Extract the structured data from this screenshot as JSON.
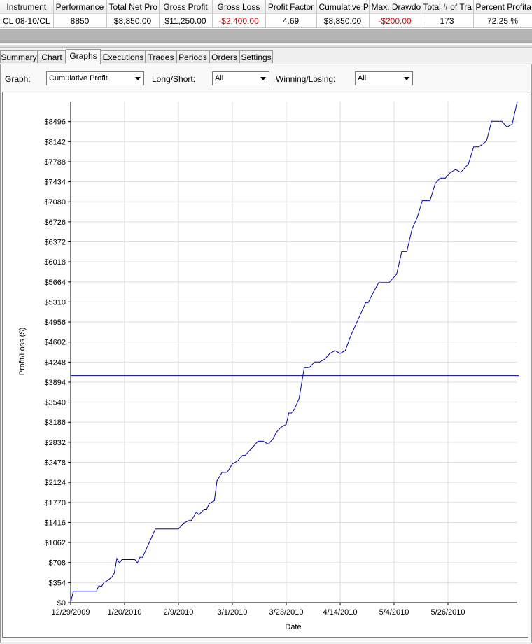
{
  "summary": {
    "columns": [
      "Instrument",
      "Performance",
      "Total Net Pro",
      "Gross Profit",
      "Gross Loss",
      "Profit Factor",
      "Cumulative P",
      "Max. Drawdo",
      "Total # of Tra",
      "Percent Profita"
    ],
    "row": [
      "CL 08-10/CL",
      "8850",
      "$8,850.00",
      "$11,250.00",
      "-$2,400.00",
      "4.69",
      "$8,850.00",
      "-$200.00",
      "173",
      "72.25 %"
    ],
    "negative_color": "#e00000"
  },
  "tabs": [
    "Summary",
    "Chart",
    "Graphs",
    "Executions",
    "Trades",
    "Periods",
    "Orders",
    "Settings"
  ],
  "active_tab": "Graphs",
  "filters": {
    "graph_label": "Graph:",
    "graph_value": "Cumulative Profit",
    "long_short_label": "Long/Short:",
    "long_short_value": "All",
    "winning_losing_label": "Winning/Losing:",
    "winning_losing_value": "All"
  },
  "chart_data": {
    "type": "line",
    "xlabel": "Date",
    "ylabel": "Profit/Loss ($)",
    "x_tick_labels": [
      "12/29/2009",
      "1/20/2010",
      "2/9/2010",
      "3/1/2010",
      "3/23/2010",
      "4/14/2010",
      "5/4/2010",
      "5/26/2010"
    ],
    "x_range": [
      "2009-12-29",
      "2010-06-21"
    ],
    "y_ticks": [
      0,
      354,
      708,
      1062,
      1416,
      1770,
      2124,
      2478,
      2832,
      3186,
      3540,
      3894,
      4248,
      4602,
      4956,
      5310,
      5664,
      6018,
      6372,
      6726,
      7080,
      7434,
      7788,
      8142,
      8496
    ],
    "y_tick_labels": [
      "$0",
      "$354",
      "$708",
      "$1062",
      "$1416",
      "$1770",
      "$2124",
      "$2478",
      "$2832",
      "$3186",
      "$3540",
      "$3894",
      "$4248",
      "$4602",
      "$4956",
      "$5310",
      "$5664",
      "$6018",
      "$6372",
      "$6726",
      "$7080",
      "$7434",
      "$7788",
      "$8142",
      "$8496"
    ],
    "ylim": [
      0,
      8850
    ],
    "grid": true,
    "line_color": "#0000b4",
    "reference_line": {
      "y": 4010,
      "color": "#0000b4"
    },
    "series": [
      {
        "x": [
          "2009-12-29",
          "2009-12-30",
          "2010-01-01",
          "2010-01-08",
          "2010-01-09",
          "2010-01-10",
          "2010-01-11",
          "2010-01-12",
          "2010-01-14",
          "2010-01-15",
          "2010-01-16",
          "2010-01-17",
          "2010-01-18",
          "2010-01-23",
          "2010-01-24",
          "2010-01-25",
          "2010-01-26",
          "2010-01-28",
          "2010-01-29",
          "2010-01-30",
          "2010-01-31",
          "2010-02-09",
          "2010-02-11",
          "2010-02-13",
          "2010-02-14",
          "2010-02-16",
          "2010-02-17",
          "2010-02-19",
          "2010-02-20",
          "2010-02-21",
          "2010-02-23",
          "2010-02-24",
          "2010-02-26",
          "2010-02-28",
          "2010-03-02",
          "2010-03-04",
          "2010-03-06",
          "2010-03-07",
          "2010-03-09",
          "2010-03-11",
          "2010-03-12",
          "2010-03-14",
          "2010-03-16",
          "2010-03-18",
          "2010-03-19",
          "2010-03-20",
          "2010-03-21",
          "2010-03-23",
          "2010-03-24",
          "2010-03-25",
          "2010-03-26",
          "2010-03-28",
          "2010-03-30",
          "2010-04-01",
          "2010-04-03",
          "2010-04-05",
          "2010-04-07",
          "2010-04-09",
          "2010-04-11",
          "2010-04-13",
          "2010-04-15",
          "2010-04-17",
          "2010-04-19",
          "2010-04-21",
          "2010-04-23",
          "2010-04-24",
          "2010-04-25",
          "2010-04-28",
          "2010-04-30",
          "2010-05-02",
          "2010-05-05",
          "2010-05-07",
          "2010-05-09",
          "2010-05-11",
          "2010-05-13",
          "2010-05-15",
          "2010-05-18",
          "2010-05-20",
          "2010-05-22",
          "2010-05-24",
          "2010-05-26",
          "2010-05-28",
          "2010-05-30",
          "2010-06-02",
          "2010-06-04",
          "2010-06-06",
          "2010-06-09",
          "2010-06-11",
          "2010-06-13",
          "2010-06-15",
          "2010-06-17",
          "2010-06-19",
          "2010-06-21"
        ],
        "y": [
          0,
          200,
          200,
          200,
          300,
          280,
          360,
          380,
          450,
          520,
          780,
          700,
          760,
          760,
          700,
          800,
          800,
          1000,
          1100,
          1200,
          1300,
          1300,
          1400,
          1450,
          1450,
          1600,
          1550,
          1650,
          1650,
          1750,
          1800,
          2150,
          2300,
          2300,
          2450,
          2500,
          2600,
          2600,
          2700,
          2800,
          2850,
          2850,
          2800,
          2900,
          3000,
          3050,
          3100,
          3150,
          3350,
          3350,
          3400,
          3600,
          4150,
          4150,
          4250,
          4250,
          4300,
          4400,
          4450,
          4400,
          4450,
          4700,
          4900,
          5100,
          5300,
          5300,
          5400,
          5650,
          5650,
          5650,
          5800,
          6200,
          6200,
          6600,
          6800,
          7100,
          7100,
          7400,
          7500,
          7500,
          7600,
          7650,
          7600,
          7750,
          8050,
          8050,
          8150,
          8500,
          8500,
          8500,
          8400,
          8450,
          8850
        ]
      }
    ]
  }
}
